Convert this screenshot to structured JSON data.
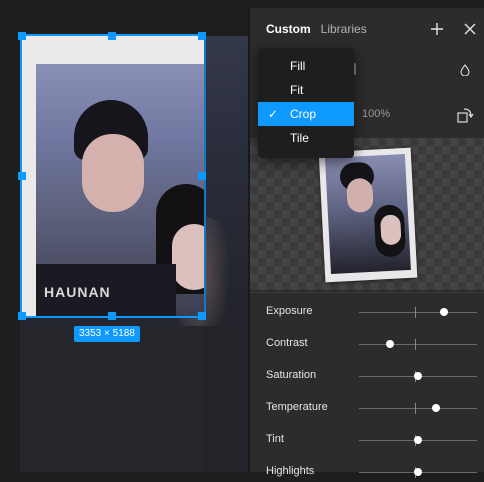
{
  "canvas": {
    "size_badge": "3353 × 5188",
    "photo_text": "HAUNAN"
  },
  "panel": {
    "tabs": [
      {
        "label": "Custom",
        "active": true
      },
      {
        "label": "Libraries",
        "active": false
      }
    ],
    "icons": {
      "add": "plus-icon",
      "close": "close-icon",
      "blend": "drop-icon",
      "rotate": "rotate-icon"
    },
    "opacity": "100%",
    "adjustments": [
      {
        "label": "Exposure",
        "level": 0.72
      },
      {
        "label": "Contrast",
        "level": 0.26
      },
      {
        "label": "Saturation",
        "level": 0.5
      },
      {
        "label": "Temperature",
        "level": 0.65
      },
      {
        "label": "Tint",
        "level": 0.5
      },
      {
        "label": "Highlights",
        "level": 0.5
      }
    ]
  },
  "dropdown": {
    "items": [
      {
        "label": "Fill",
        "selected": false
      },
      {
        "label": "Fit",
        "selected": false
      },
      {
        "label": "Crop",
        "selected": true
      },
      {
        "label": "Tile",
        "selected": false
      }
    ],
    "check_glyph": "✓"
  },
  "colors": {
    "accent": "#0d99ff",
    "panel_bg": "#2c2c2c",
    "canvas_bg": "#1e1e1e"
  }
}
